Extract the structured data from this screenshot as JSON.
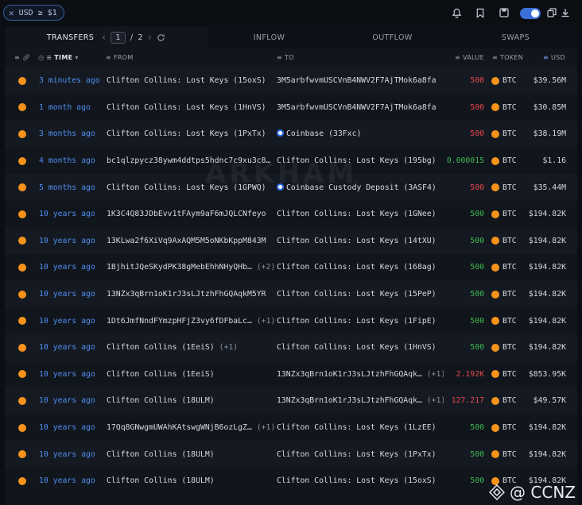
{
  "filter": {
    "label": "USD ≥ $1"
  },
  "tabs": {
    "transfers": "TRANSFERS",
    "page_current": "1",
    "page_sep": "/",
    "page_total": "2",
    "inflow": "INFLOW",
    "outflow": "OUTFLOW",
    "swaps": "SWAPS"
  },
  "columns": {
    "time": "TIME",
    "from": "FROM",
    "to": "TO",
    "value": "VALUE",
    "token": "TOKEN",
    "usd": "USD"
  },
  "watermark": "ARKHAM",
  "corner_mark": "@ CCNZ",
  "rows": [
    {
      "time": "3 minutes ago",
      "from": "Clifton Collins: Lost Keys (15oxS)",
      "from_plus": "",
      "to": "3M5arbfwvmUSCVnB4NWV2F7AjTMok6a8fa",
      "to_plus": "",
      "to_icon": false,
      "value": "500",
      "value_color": "red",
      "token": "BTC",
      "usd": "$39.56M"
    },
    {
      "time": "1 month ago",
      "from": "Clifton Collins: Lost Keys (1HnVS)",
      "from_plus": "",
      "to": "3M5arbfwvmUSCVnB4NWV2F7AjTMok6a8fa",
      "to_plus": "",
      "to_icon": false,
      "value": "500",
      "value_color": "red",
      "token": "BTC",
      "usd": "$30.85M"
    },
    {
      "time": "3 months ago",
      "from": "Clifton Collins: Lost Keys (1PxTx)",
      "from_plus": "",
      "to": "Coinbase (33Fxc)",
      "to_plus": "",
      "to_icon": true,
      "value": "500",
      "value_color": "red",
      "token": "BTC",
      "usd": "$38.19M"
    },
    {
      "time": "4 months ago",
      "from": "bc1qlzpycz38ywm4ddtps5hdnc7c9xu3c8…",
      "from_plus": "",
      "to": "Clifton Collins: Lost Keys (195bg)",
      "to_plus": "",
      "to_icon": false,
      "value": "0.000015",
      "value_color": "green",
      "token": "BTC",
      "usd": "$1.16"
    },
    {
      "time": "5 months ago",
      "from": "Clifton Collins: Lost Keys (1GPWQ)",
      "from_plus": "",
      "to": "Coinbase Custody Deposit (3ASF4)",
      "to_plus": "",
      "to_icon": true,
      "value": "500",
      "value_color": "red",
      "token": "BTC",
      "usd": "$35.44M"
    },
    {
      "time": "10 years ago",
      "from": "1K3C4Q83JDbEvv1tFAym9aF6mJQLCNfeyo",
      "from_plus": "",
      "to": "Clifton Collins: Lost Keys (1GNee)",
      "to_plus": "",
      "to_icon": false,
      "value": "500",
      "value_color": "green",
      "token": "BTC",
      "usd": "$194.82K"
    },
    {
      "time": "10 years ago",
      "from": "13KLwa2f6XiVq9AxAQM5M5oNKbKppM843M",
      "from_plus": "",
      "to": "Clifton Collins: Lost Keys (14tXU)",
      "to_plus": "",
      "to_icon": false,
      "value": "500",
      "value_color": "green",
      "token": "BTC",
      "usd": "$194.82K"
    },
    {
      "time": "10 years ago",
      "from": "1BjhitJQeSKydPK38gMebEhhNHyQHb…",
      "from_plus": "(+2)",
      "to": "Clifton Collins: Lost Keys (168ag)",
      "to_plus": "",
      "to_icon": false,
      "value": "500",
      "value_color": "green",
      "token": "BTC",
      "usd": "$194.82K"
    },
    {
      "time": "10 years ago",
      "from": "13NZx3qBrn1oK1rJ3sLJtzhFhGQAqkM5YR",
      "from_plus": "",
      "to": "Clifton Collins: Lost Keys (15PeP)",
      "to_plus": "",
      "to_icon": false,
      "value": "500",
      "value_color": "green",
      "token": "BTC",
      "usd": "$194.82K"
    },
    {
      "time": "10 years ago",
      "from": "1Dt6JmfNndFYmzpHFjZ3vy6fDFbaLc…",
      "from_plus": "(+1)",
      "to": "Clifton Collins: Lost Keys (1FipE)",
      "to_plus": "",
      "to_icon": false,
      "value": "500",
      "value_color": "green",
      "token": "BTC",
      "usd": "$194.82K"
    },
    {
      "time": "10 years ago",
      "from": "Clifton Collins (1EeiS)",
      "from_plus": "(+1)",
      "to": "Clifton Collins: Lost Keys (1HnVS)",
      "to_plus": "",
      "to_icon": false,
      "value": "500",
      "value_color": "green",
      "token": "BTC",
      "usd": "$194.82K"
    },
    {
      "time": "10 years ago",
      "from": "Clifton Collins (1EeiS)",
      "from_plus": "",
      "to": "13NZx3qBrn1oK1rJ3sLJtzhFhGQAqk…",
      "to_plus": "(+1)",
      "to_icon": false,
      "value": "2.192K",
      "value_color": "red",
      "token": "BTC",
      "usd": "$853.95K"
    },
    {
      "time": "10 years ago",
      "from": "Clifton Collins (18ULM)",
      "from_plus": "",
      "to": "13NZx3qBrn1oK1rJ3sLJtzhFhGQAqk…",
      "to_plus": "(+1)",
      "to_icon": false,
      "value": "127.217",
      "value_color": "red",
      "token": "BTC",
      "usd": "$49.57K"
    },
    {
      "time": "10 years ago",
      "from": "17Qq8GNwgmUWAhKAtswgWNjB6ozLgZ…",
      "from_plus": "(+1)",
      "to": "Clifton Collins: Lost Keys (1LzEE)",
      "to_plus": "",
      "to_icon": false,
      "value": "500",
      "value_color": "green",
      "token": "BTC",
      "usd": "$194.82K"
    },
    {
      "time": "10 years ago",
      "from": "Clifton Collins (18ULM)",
      "from_plus": "",
      "to": "Clifton Collins: Lost Keys (1PxTx)",
      "to_plus": "",
      "to_icon": false,
      "value": "500",
      "value_color": "green",
      "token": "BTC",
      "usd": "$194.82K"
    },
    {
      "time": "10 years ago",
      "from": "Clifton Collins (18ULM)",
      "from_plus": "",
      "to": "Clifton Collins: Lost Keys (15oxS)",
      "to_plus": "",
      "to_icon": false,
      "value": "500",
      "value_color": "green",
      "token": "BTC",
      "usd": "$194.82K"
    }
  ],
  "icons": {
    "token_icon": "bitcoin-icon",
    "coinbase": "coinbase-icon"
  },
  "colors": {
    "accent": "#3b6fd9",
    "time_link": "#4f8ef0",
    "out": "#e5484d",
    "in": "#3fb950",
    "btc": "#f7931a"
  }
}
